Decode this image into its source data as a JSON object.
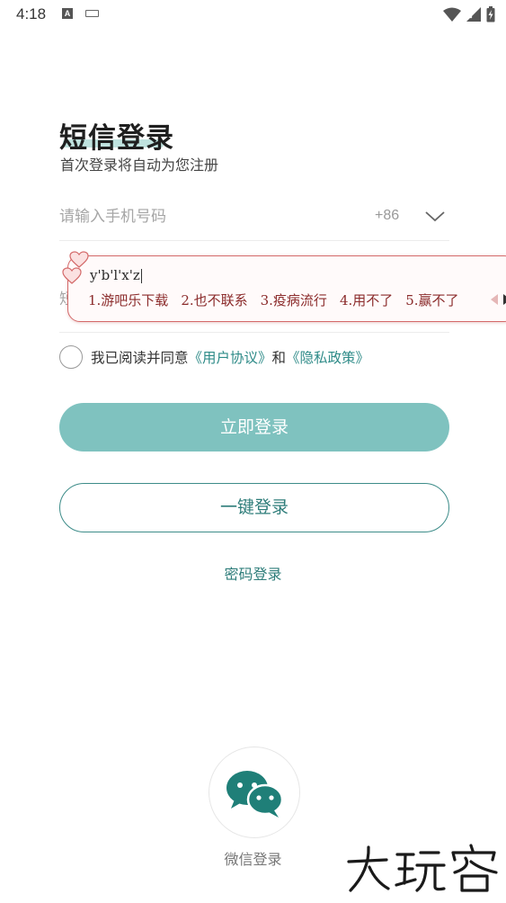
{
  "status_bar": {
    "time": "4:18",
    "icons": [
      "a-notification-icon",
      "keyboard-icon",
      "wifi-icon",
      "signal-icon",
      "battery-charging-icon"
    ]
  },
  "page": {
    "title": "短信登录",
    "subtitle": "首次登录将自动为您注册"
  },
  "phone": {
    "placeholder": "请输入手机号码",
    "country_code": "+86"
  },
  "sms": {
    "placeholder_visible": "短"
  },
  "ime": {
    "composition": "y'b'l'x'z",
    "candidates": [
      "1.游吧乐下载",
      "2.也不联系",
      "3.疫病流行",
      "4.用不了",
      "5.赢不了"
    ]
  },
  "agreement": {
    "prefix": "我已阅读并同意",
    "user_agreement": "《用户协议》",
    "and": "和",
    "privacy_policy": "《隐私政策》"
  },
  "buttons": {
    "login": "立即登录",
    "one_key_login": "一键登录",
    "password_login": "密码登录"
  },
  "wechat": {
    "label": "微信登录"
  },
  "watermark": {
    "text": "大玩客"
  },
  "colors": {
    "accent": "#2e7d7a",
    "button_fill": "#7fc2bf",
    "ime_border": "#d46a6a",
    "wechat_green": "#1f7f78"
  }
}
